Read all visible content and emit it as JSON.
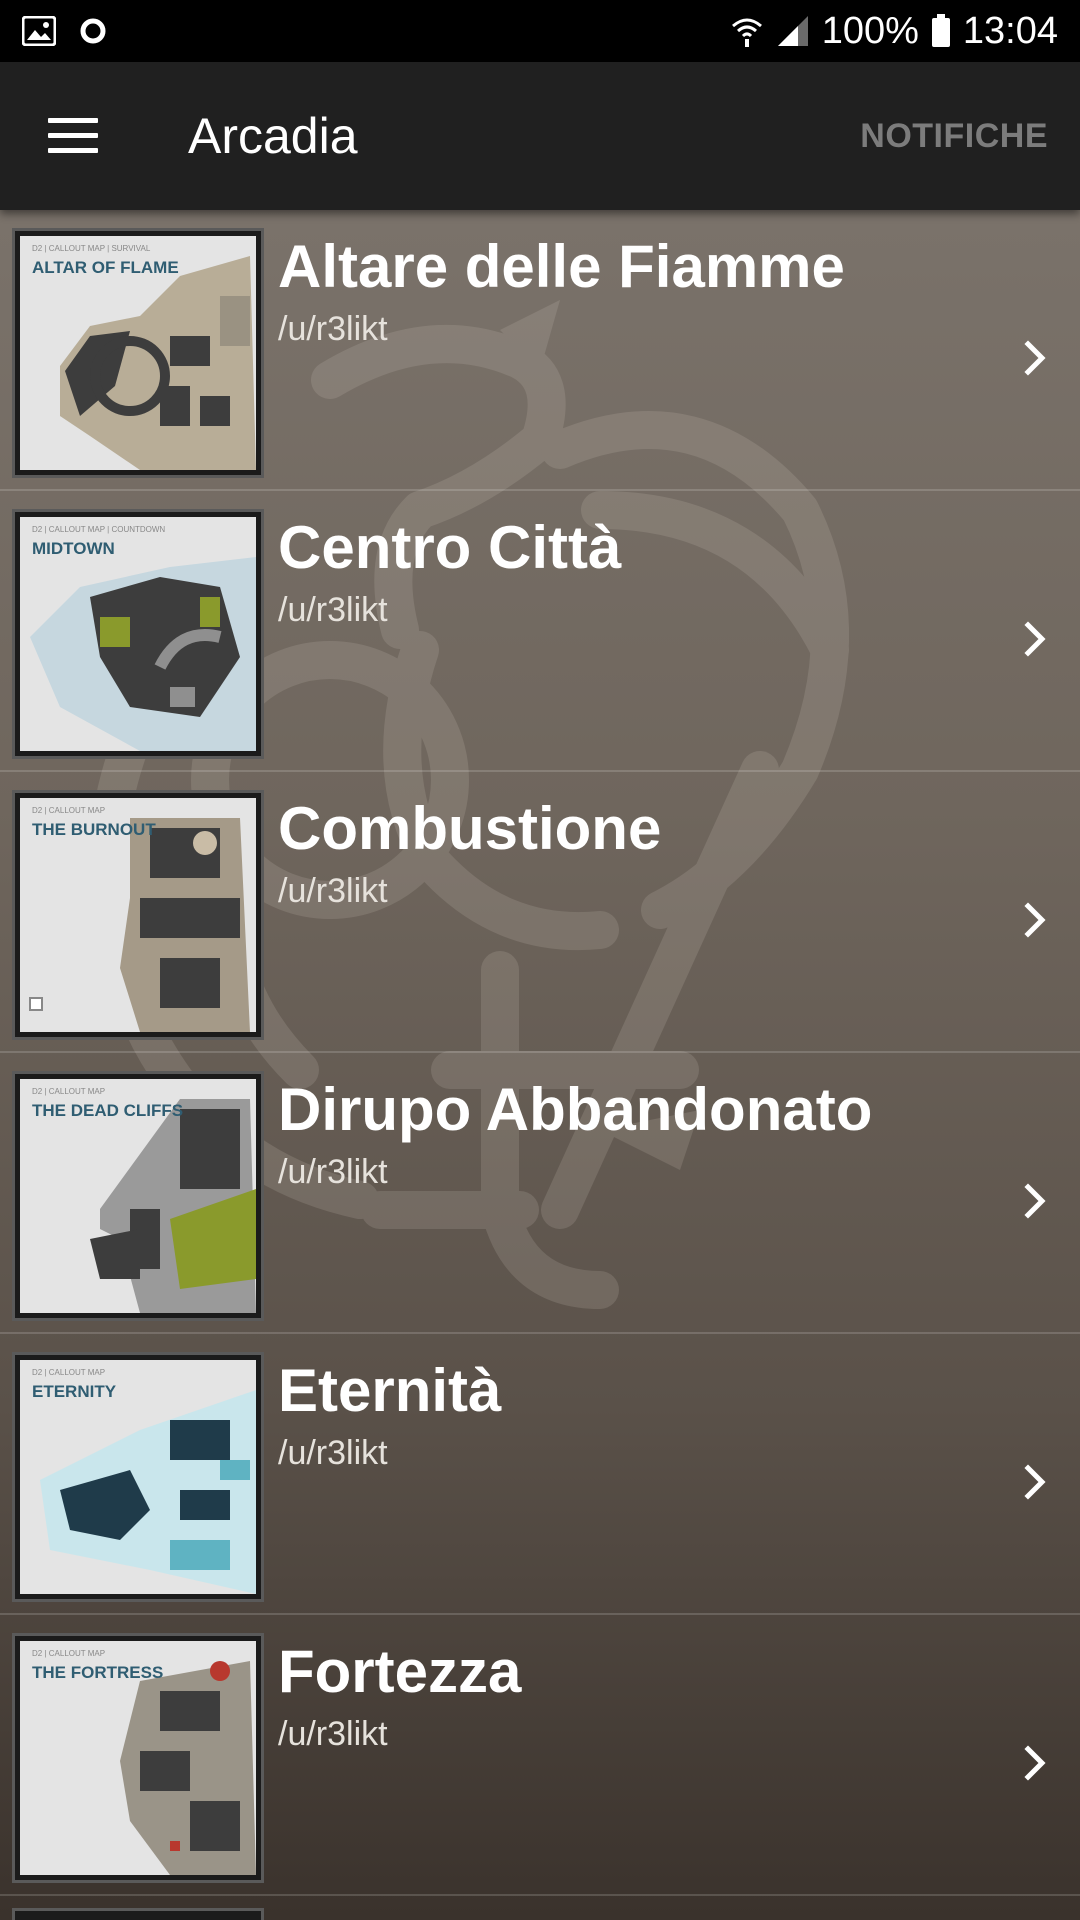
{
  "status_bar": {
    "left_icons": [
      "image-icon",
      "circle-icon"
    ],
    "battery_percent": "100%",
    "time": "13:04"
  },
  "app_bar": {
    "title": "Arcadia",
    "action": "NOTIFICHE",
    "menu_icon": "hamburger-menu-icon"
  },
  "maps": [
    {
      "title": "Altare delle Fiamme",
      "author": "/u/r3likt",
      "thumb_label": "ALTAR OF FLAME",
      "thumb_small": "D2 | CALLOUT MAP | SURVIVAL"
    },
    {
      "title": "Centro Città",
      "author": "/u/r3likt",
      "thumb_label": "MIDTOWN",
      "thumb_small": "D2 | CALLOUT MAP | COUNTDOWN"
    },
    {
      "title": "Combustione",
      "author": "/u/r3likt",
      "thumb_label": "THE BURNOUT",
      "thumb_small": "D2 | CALLOUT MAP"
    },
    {
      "title": "Dirupo Abbandonato",
      "author": "/u/r3likt",
      "thumb_label": "THE DEAD CLIFFS",
      "thumb_small": "D2 | CALLOUT MAP"
    },
    {
      "title": "Eternità",
      "author": "/u/r3likt",
      "thumb_label": "ETERNITY",
      "thumb_small": "D2 | CALLOUT MAP"
    },
    {
      "title": "Fortezza",
      "author": "/u/r3likt",
      "thumb_label": "THE FORTRESS",
      "thumb_small": "D2 | CALLOUT MAP"
    }
  ],
  "colors": {
    "app_bar": "#202020",
    "status_bar": "#000000",
    "action_text": "#7c7c7c",
    "map_label": "#2f5d72"
  }
}
